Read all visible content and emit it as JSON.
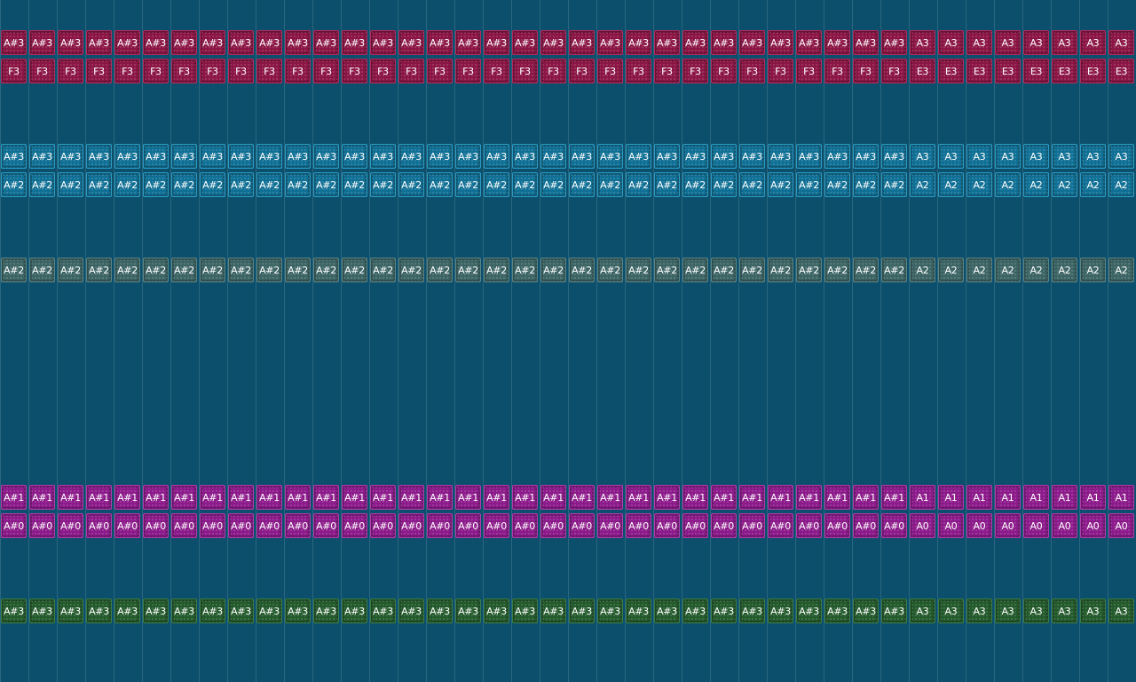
{
  "tracks": [
    {
      "id": "track-1",
      "color": "#8b1544",
      "border": "#b42a60",
      "rows": [
        {
          "notes": [
            "A#3",
            "A#3",
            "A#3",
            "A#3",
            "A#3",
            "A#3",
            "A#3",
            "A#3",
            "A#3",
            "A#3",
            "A#3",
            "A#3",
            "A#3",
            "A#3",
            "A#3",
            "A#3",
            "A#3",
            "A#3",
            "A#3",
            "A#3",
            "A#3",
            "A#3",
            "A#3",
            "A#3",
            "A#3",
            "A#3",
            "A#3",
            "A#3",
            "A#3",
            "A#3",
            "A#3",
            "A#3",
            "A3",
            "A3",
            "A3",
            "A3",
            "A3",
            "A3",
            "A3",
            "A3"
          ]
        },
        {
          "notes": [
            "F3",
            "F3",
            "F3",
            "F3",
            "F3",
            "F3",
            "F3",
            "F3",
            "F3",
            "F3",
            "F3",
            "F3",
            "F3",
            "F3",
            "F3",
            "F3",
            "F3",
            "F3",
            "F3",
            "F3",
            "F3",
            "F3",
            "F3",
            "F3",
            "F3",
            "F3",
            "F3",
            "F3",
            "F3",
            "F3",
            "F3",
            "F3",
            "E3",
            "E3",
            "E3",
            "E3",
            "E3",
            "E3",
            "E3",
            "E3"
          ]
        }
      ]
    },
    {
      "id": "track-2",
      "color": "#0f6f94",
      "border": "#2a9cc4",
      "rows": [
        {
          "notes": [
            "A#3",
            "A#3",
            "A#3",
            "A#3",
            "A#3",
            "A#3",
            "A#3",
            "A#3",
            "A#3",
            "A#3",
            "A#3",
            "A#3",
            "A#3",
            "A#3",
            "A#3",
            "A#3",
            "A#3",
            "A#3",
            "A#3",
            "A#3",
            "A#3",
            "A#3",
            "A#3",
            "A#3",
            "A#3",
            "A#3",
            "A#3",
            "A#3",
            "A#3",
            "A#3",
            "A#3",
            "A#3",
            "A3",
            "A3",
            "A3",
            "A3",
            "A3",
            "A3",
            "A3",
            "A3"
          ]
        },
        {
          "notes": [
            "A#2",
            "A#2",
            "A#2",
            "A#2",
            "A#2",
            "A#2",
            "A#2",
            "A#2",
            "A#2",
            "A#2",
            "A#2",
            "A#2",
            "A#2",
            "A#2",
            "A#2",
            "A#2",
            "A#2",
            "A#2",
            "A#2",
            "A#2",
            "A#2",
            "A#2",
            "A#2",
            "A#2",
            "A#2",
            "A#2",
            "A#2",
            "A#2",
            "A#2",
            "A#2",
            "A#2",
            "A#2",
            "A2",
            "A2",
            "A2",
            "A2",
            "A2",
            "A2",
            "A2",
            "A2"
          ]
        }
      ]
    },
    {
      "id": "track-3",
      "color": "#3c6464",
      "border": "#5a8585",
      "rows": [
        {
          "notes": [
            "A#2",
            "A#2",
            "A#2",
            "A#2",
            "A#2",
            "A#2",
            "A#2",
            "A#2",
            "A#2",
            "A#2",
            "A#2",
            "A#2",
            "A#2",
            "A#2",
            "A#2",
            "A#2",
            "A#2",
            "A#2",
            "A#2",
            "A#2",
            "A#2",
            "A#2",
            "A#2",
            "A#2",
            "A#2",
            "A#2",
            "A#2",
            "A#2",
            "A#2",
            "A#2",
            "A#2",
            "A#2",
            "A2",
            "A2",
            "A2",
            "A2",
            "A2",
            "A2",
            "A2",
            "A2"
          ]
        }
      ]
    },
    {
      "id": "track-4",
      "color": "#8c1a8a",
      "border": "#b23ab0",
      "rows": [
        {
          "notes": [
            "A#1",
            "A#1",
            "A#1",
            "A#1",
            "A#1",
            "A#1",
            "A#1",
            "A#1",
            "A#1",
            "A#1",
            "A#1",
            "A#1",
            "A#1",
            "A#1",
            "A#1",
            "A#1",
            "A#1",
            "A#1",
            "A#1",
            "A#1",
            "A#1",
            "A#1",
            "A#1",
            "A#1",
            "A#1",
            "A#1",
            "A#1",
            "A#1",
            "A#1",
            "A#1",
            "A#1",
            "A#1",
            "A1",
            "A1",
            "A1",
            "A1",
            "A1",
            "A1",
            "A1",
            "A1"
          ]
        },
        {
          "notes": [
            "A#0",
            "A#0",
            "A#0",
            "A#0",
            "A#0",
            "A#0",
            "A#0",
            "A#0",
            "A#0",
            "A#0",
            "A#0",
            "A#0",
            "A#0",
            "A#0",
            "A#0",
            "A#0",
            "A#0",
            "A#0",
            "A#0",
            "A#0",
            "A#0",
            "A#0",
            "A#0",
            "A#0",
            "A#0",
            "A#0",
            "A#0",
            "A#0",
            "A#0",
            "A#0",
            "A#0",
            "A#0",
            "A0",
            "A0",
            "A0",
            "A0",
            "A0",
            "A0",
            "A0",
            "A0"
          ]
        }
      ]
    },
    {
      "id": "track-5",
      "color": "#235a2b",
      "border": "#3b7d44",
      "rows": [
        {
          "notes": [
            "A#3",
            "A#3",
            "A#3",
            "A#3",
            "A#3",
            "A#3",
            "A#3",
            "A#3",
            "A#3",
            "A#3",
            "A#3",
            "A#3",
            "A#3",
            "A#3",
            "A#3",
            "A#3",
            "A#3",
            "A#3",
            "A#3",
            "A#3",
            "A#3",
            "A#3",
            "A#3",
            "A#3",
            "A#3",
            "A#3",
            "A#3",
            "A#3",
            "A#3",
            "A#3",
            "A#3",
            "A#3",
            "A3",
            "A3",
            "A3",
            "A3",
            "A3",
            "A3",
            "A3",
            "A3"
          ]
        }
      ]
    }
  ]
}
